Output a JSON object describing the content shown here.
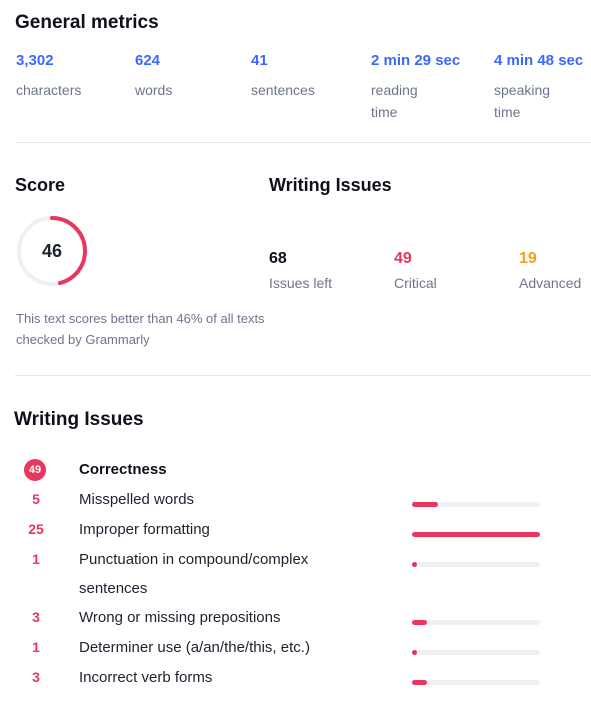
{
  "general": {
    "title": "General metrics",
    "metrics": [
      {
        "value": "3,302",
        "label": "characters"
      },
      {
        "value": "624",
        "label": "words"
      },
      {
        "value": "41",
        "label": "sentences"
      },
      {
        "value": "2 min 29 sec",
        "label": "reading time"
      },
      {
        "value": "4 min 48 sec",
        "label": "speaking time"
      }
    ]
  },
  "score": {
    "title": "Score",
    "value": "46",
    "percent": 46,
    "description": "This text scores better than 46% of all texts checked by Grammarly"
  },
  "writing_summary": {
    "title": "Writing Issues",
    "items": [
      {
        "value": "68",
        "label": "Issues left",
        "color": "#0e101a"
      },
      {
        "value": "49",
        "label": "Critical",
        "color": "#e8365f"
      },
      {
        "value": "19",
        "label": "Advanced",
        "color": "#f0a020"
      }
    ]
  },
  "issues": {
    "title": "Writing Issues",
    "category": {
      "count": "49",
      "label": "Correctness"
    },
    "rows": [
      {
        "count": "5",
        "label": "Misspelled words",
        "fraction": 0.2
      },
      {
        "count": "25",
        "label": "Improper formatting",
        "fraction": 1.0
      },
      {
        "count": "1",
        "label": "Punctuation in compound/complex sentences",
        "fraction": 0.04
      },
      {
        "count": "3",
        "label": "Wrong or missing prepositions",
        "fraction": 0.12
      },
      {
        "count": "1",
        "label": "Determiner use (a/an/the/this, etc.)",
        "fraction": 0.04
      },
      {
        "count": "3",
        "label": "Incorrect verb forms",
        "fraction": 0.12
      }
    ]
  },
  "colors": {
    "accent": "#3b68ff",
    "critical": "#e8365f",
    "advanced": "#f0a020"
  }
}
